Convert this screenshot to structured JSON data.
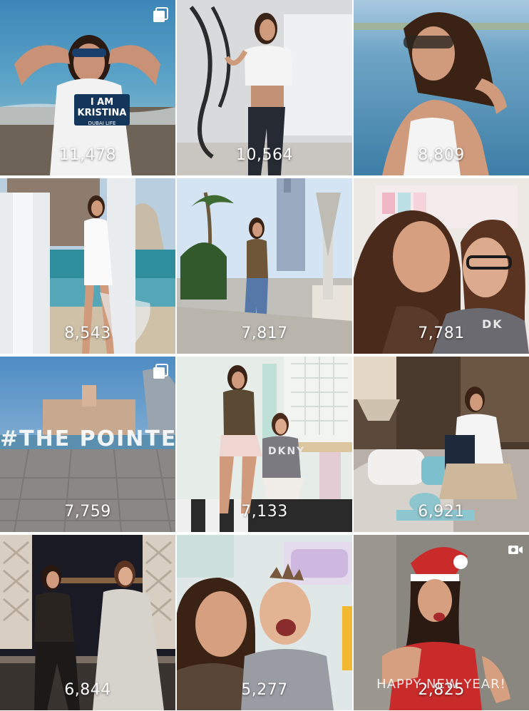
{
  "grid": {
    "tiles": [
      {
        "count": "11,478",
        "badge": "multiple-photos-icon",
        "overlay": "I AM KRISTINA",
        "overlay_sub": "DUBAI LIFE"
      },
      {
        "count": "10,564"
      },
      {
        "count": "8,809"
      },
      {
        "count": "8,543"
      },
      {
        "count": "7,817"
      },
      {
        "count": "7,781",
        "overlay": "DK"
      },
      {
        "count": "7,759",
        "badge": "multiple-photos-icon",
        "overlay": "#THE POINTE"
      },
      {
        "count": "7,133",
        "overlay": "DKNY"
      },
      {
        "count": "6,921"
      },
      {
        "count": "6,844"
      },
      {
        "count": "5,277"
      },
      {
        "count": "2,825",
        "badge": "video-camera-icon",
        "overlay": "HAPPY NEW YEAR!"
      }
    ]
  },
  "colors": {
    "count_text": "#ffffff",
    "background": "#ffffff"
  }
}
